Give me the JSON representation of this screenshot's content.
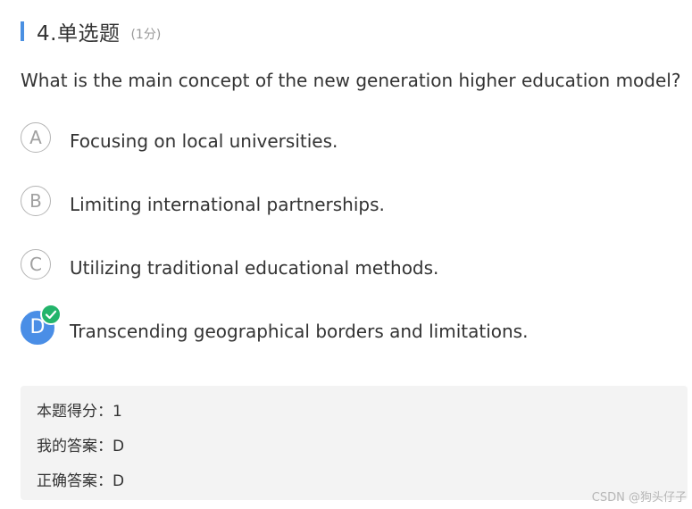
{
  "header": {
    "title": "4.单选题",
    "score": "(1分)"
  },
  "question": {
    "text": "What is the main concept of the new generation higher education model?"
  },
  "options": [
    {
      "letter": "A",
      "text": "Focusing on local universities.",
      "selected": false
    },
    {
      "letter": "B",
      "text": "Limiting international partnerships.",
      "selected": false
    },
    {
      "letter": "C",
      "text": "Utilizing traditional educational methods.",
      "selected": false
    },
    {
      "letter": "D",
      "text": "Transcending geographical borders and limitations.",
      "selected": true
    }
  ],
  "result": {
    "score_line": "本题得分：1",
    "my_answer_line": "我的答案：D",
    "correct_answer_line": "正确答案：D"
  },
  "watermark": "CSDN @狗头仔子",
  "colors": {
    "accent": "#4a90e2",
    "selected": "#4a8ee6",
    "correct_check": "#23b46b"
  }
}
